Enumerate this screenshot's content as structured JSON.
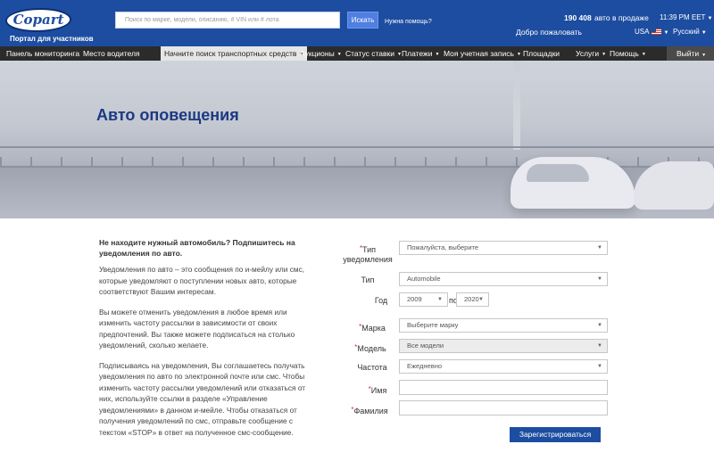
{
  "header": {
    "logo_text": "Copart",
    "tagline": "Портал для участников",
    "search_placeholder": "Поиск по марке, модели, описанию, # VIN или # лота",
    "search_button": "Искать",
    "help_link": "Нужна помощь?",
    "vehicle_count": "190 408",
    "vehicle_count_label": "авто в продаже",
    "time": "11:39 PM EET",
    "welcome": "Добро пожаловать",
    "country": "USA",
    "language": "Русский"
  },
  "nav": {
    "items": [
      {
        "label": "Панель мониторинга",
        "dropdown": false
      },
      {
        "label": "Место водителя",
        "dropdown": false
      },
      {
        "label": "Начните поиск транспортных средств",
        "dropdown": true
      },
      {
        "label": "Аукционы",
        "dropdown": true
      },
      {
        "label": "Статус ставки",
        "dropdown": true
      },
      {
        "label": "Платежи",
        "dropdown": true
      },
      {
        "label": "Моя учетная запись",
        "dropdown": true
      },
      {
        "label": "Площадки",
        "dropdown": false
      },
      {
        "label": "Услуги",
        "dropdown": true
      },
      {
        "label": "Помощь",
        "dropdown": true
      }
    ],
    "logout": "Выйти"
  },
  "hero": {
    "title": "Авто оповещения"
  },
  "intro": {
    "heading": "Не находите нужный автомобиль? Подпишитесь на уведомления по авто.",
    "p1": "Уведомления по авто – это сообщения по и-мейлу или смс, которые уведомляют о поступлении новых авто, которые соответствуют Вашим интересам.",
    "p2": "Вы можете отменить уведомления в любое время или изменить частоту рассылки в зависимости от своих предпочтений. Вы также можете подписаться на столько уведомлений, сколько желаете.",
    "p3": "Подписываясь на уведомления, Вы соглашаетесь получать уведомления по авто по электронной почте или смс. Чтобы изменить частоту рассылки уведомлений или отказаться от них, используйте ссылки в разделе «Управление уведомлениями» в данном и-мейле. Чтобы отказаться от получения уведомлений по смс, отправьте сообщение с текстом «STOP» в ответ на полученное смс-сообщение."
  },
  "form": {
    "notification_type_label": "Тип уведомления",
    "notification_type_value": "Пожалуйста, выберите",
    "type_label": "Тип",
    "type_value": "Automobile",
    "year_label": "Год",
    "year_from": "2009",
    "year_to_label": "по",
    "year_to": "2020",
    "make_label": "Марка",
    "make_value": "Выберите марку",
    "model_label": "Модель",
    "model_value": "Все модели",
    "frequency_label": "Частота",
    "frequency_value": "Ежедневно",
    "first_name_label": "Имя",
    "last_name_label": "Фамилия",
    "required_mark": "*",
    "submit": "Зарегистрироваться"
  },
  "colors": {
    "header_blue": "#1d4da0",
    "nav_dark": "#2b2b2b",
    "title_blue": "#1b3a82",
    "required_red": "#c0392b"
  }
}
